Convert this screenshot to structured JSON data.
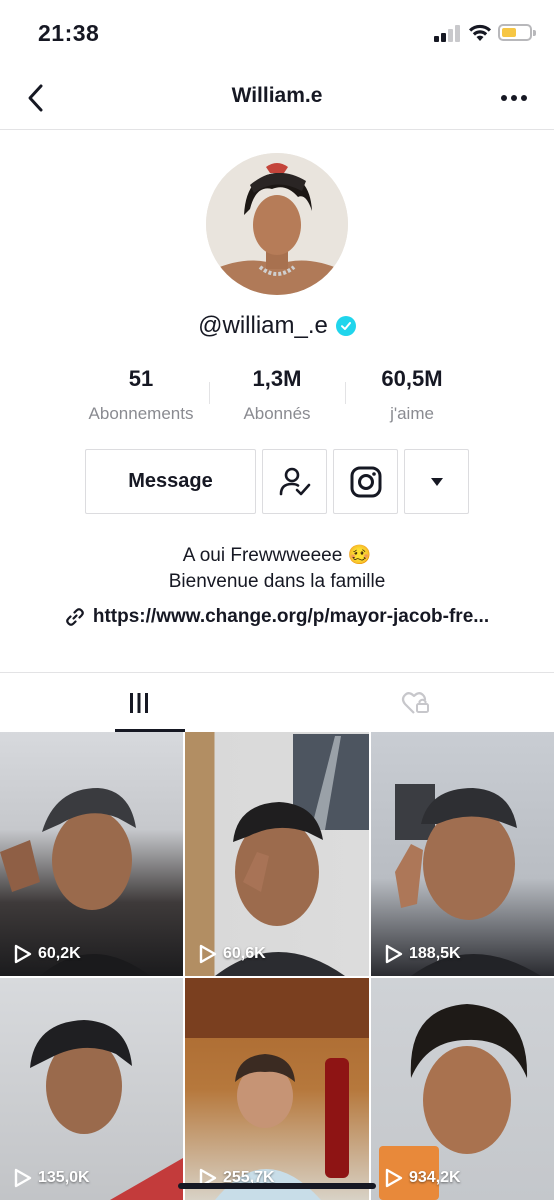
{
  "status_bar": {
    "time": "21:38"
  },
  "nav": {
    "title": "William.e"
  },
  "profile": {
    "username": "@william_.e",
    "verified": true,
    "stats": [
      {
        "value": "51",
        "label": "Abonnements"
      },
      {
        "value": "1,3M",
        "label": "Abonnés"
      },
      {
        "value": "60,5M",
        "label": "j'aime"
      }
    ],
    "bio_line1": "A oui Frewwweeee 🥴",
    "bio_line2": "Bienvenue dans la famille",
    "link": "https://www.change.org/p/mayor-jacob-fre..."
  },
  "actions": {
    "message_label": "Message"
  },
  "icons": {
    "back": "chevron-left-icon",
    "more": "more-horizontal-icon",
    "verified": "verified-badge-icon",
    "friend": "user-check-icon",
    "instagram": "instagram-icon",
    "dropdown": "caret-down-icon",
    "link": "link-icon",
    "videos_tab": "grid-bars-icon",
    "liked_tab": "heart-lock-icon",
    "play": "play-icon"
  },
  "videos": [
    {
      "views": "60,2K"
    },
    {
      "views": "60,6K"
    },
    {
      "views": "188,5K"
    },
    {
      "views": "135,0K"
    },
    {
      "views": "255,7K"
    },
    {
      "views": "934,2K"
    }
  ],
  "colors": {
    "verified": "#20d5ec",
    "text": "#161823",
    "muted": "#8a8b91",
    "battery": "#f6c644"
  }
}
